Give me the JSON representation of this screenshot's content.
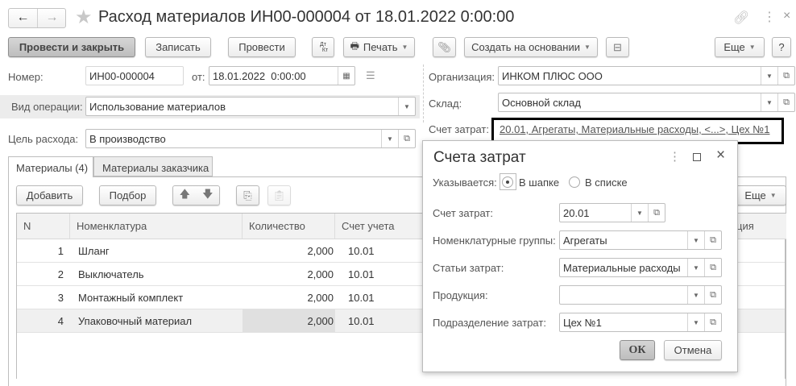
{
  "window": {
    "title": "Расход материалов ИН00-000004 от 18.01.2022 0:00:00"
  },
  "toolbar": {
    "post_close": "Провести и закрыть",
    "save": "Записать",
    "post": "Провести",
    "dtkt_top": "Дт",
    "dtkt_bottom": "Кт",
    "print": "Печать",
    "create_based": "Создать на основании",
    "more": "Еще",
    "help": "?"
  },
  "form": {
    "number_label": "Номер:",
    "number": "ИН00-000004",
    "date_label": "от:",
    "date": "18.01.2022  0:00:00",
    "op_label": "Вид операции:",
    "op": "Использование материалов",
    "purpose_label": "Цель расхода:",
    "purpose": "В производство",
    "org_label": "Организация:",
    "org": "ИНКОМ ПЛЮС ООО",
    "warehouse_label": "Склад:",
    "warehouse": "Основной склад",
    "cost_label": "Счет затрат:",
    "cost_link": "20.01, Агрегаты, Материальные расходы, <...>, Цех №1"
  },
  "tabs": [
    {
      "label": "Материалы (4)"
    },
    {
      "label": "Материалы заказчика"
    }
  ],
  "panel": {
    "add": "Добавить",
    "select": "Подбор",
    "more": "Еще"
  },
  "table": {
    "headers": [
      "N",
      "Номенклатура",
      "Количество",
      "Счет учета",
      "ция"
    ],
    "rows": [
      {
        "n": "1",
        "name": "Шланг",
        "qty": "2,000",
        "acc": "10.01"
      },
      {
        "n": "2",
        "name": "Выключатель",
        "qty": "2,000",
        "acc": "10.01"
      },
      {
        "n": "3",
        "name": "Монтажный комплект",
        "qty": "2,000",
        "acc": "10.01"
      },
      {
        "n": "4",
        "name": "Упаковочный материал",
        "qty": "2,000",
        "acc": "10.01"
      }
    ]
  },
  "dialog": {
    "title": "Счета затрат",
    "specified_label": "Указывается:",
    "opt_header": "В шапке",
    "opt_list": "В списке",
    "account_label": "Счет затрат:",
    "account": "20.01",
    "groups_label": "Номенклатурные группы:",
    "groups": "Агрегаты",
    "items_label": "Статьи затрат:",
    "items": "Материальные расходы",
    "product_label": "Продукция:",
    "product": "",
    "division_label": "Подразделение затрат:",
    "division": "Цех №1",
    "ok": "ОК",
    "cancel": "Отмена"
  }
}
